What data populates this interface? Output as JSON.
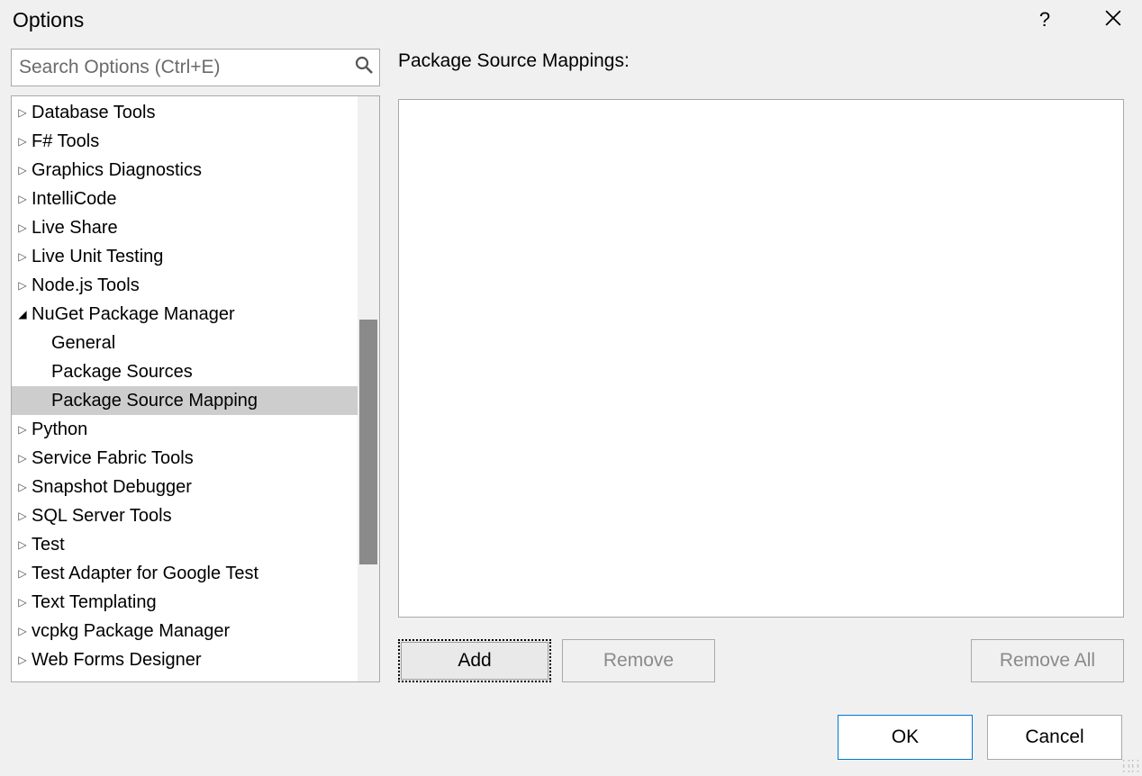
{
  "title": "Options",
  "search": {
    "placeholder": "Search Options (Ctrl+E)"
  },
  "tree": {
    "items": [
      {
        "label": "Database Tools",
        "expanded": false,
        "children": []
      },
      {
        "label": "F# Tools",
        "expanded": false,
        "children": []
      },
      {
        "label": "Graphics Diagnostics",
        "expanded": false,
        "children": []
      },
      {
        "label": "IntelliCode",
        "expanded": false,
        "children": []
      },
      {
        "label": "Live Share",
        "expanded": false,
        "children": []
      },
      {
        "label": "Live Unit Testing",
        "expanded": false,
        "children": []
      },
      {
        "label": "Node.js Tools",
        "expanded": false,
        "children": []
      },
      {
        "label": "NuGet Package Manager",
        "expanded": true,
        "children": [
          {
            "label": "General",
            "selected": false
          },
          {
            "label": "Package Sources",
            "selected": false
          },
          {
            "label": "Package Source Mapping",
            "selected": true
          }
        ]
      },
      {
        "label": "Python",
        "expanded": false,
        "children": []
      },
      {
        "label": "Service Fabric Tools",
        "expanded": false,
        "children": []
      },
      {
        "label": "Snapshot Debugger",
        "expanded": false,
        "children": []
      },
      {
        "label": "SQL Server Tools",
        "expanded": false,
        "children": []
      },
      {
        "label": "Test",
        "expanded": false,
        "children": []
      },
      {
        "label": "Test Adapter for Google Test",
        "expanded": false,
        "children": []
      },
      {
        "label": "Text Templating",
        "expanded": false,
        "children": []
      },
      {
        "label": "vcpkg Package Manager",
        "expanded": false,
        "children": []
      },
      {
        "label": "Web Forms Designer",
        "expanded": false,
        "children": []
      }
    ]
  },
  "right": {
    "section_label": "Package Source Mappings:",
    "buttons": {
      "add": "Add",
      "remove": "Remove",
      "remove_all": "Remove All"
    }
  },
  "footer": {
    "ok": "OK",
    "cancel": "Cancel"
  }
}
